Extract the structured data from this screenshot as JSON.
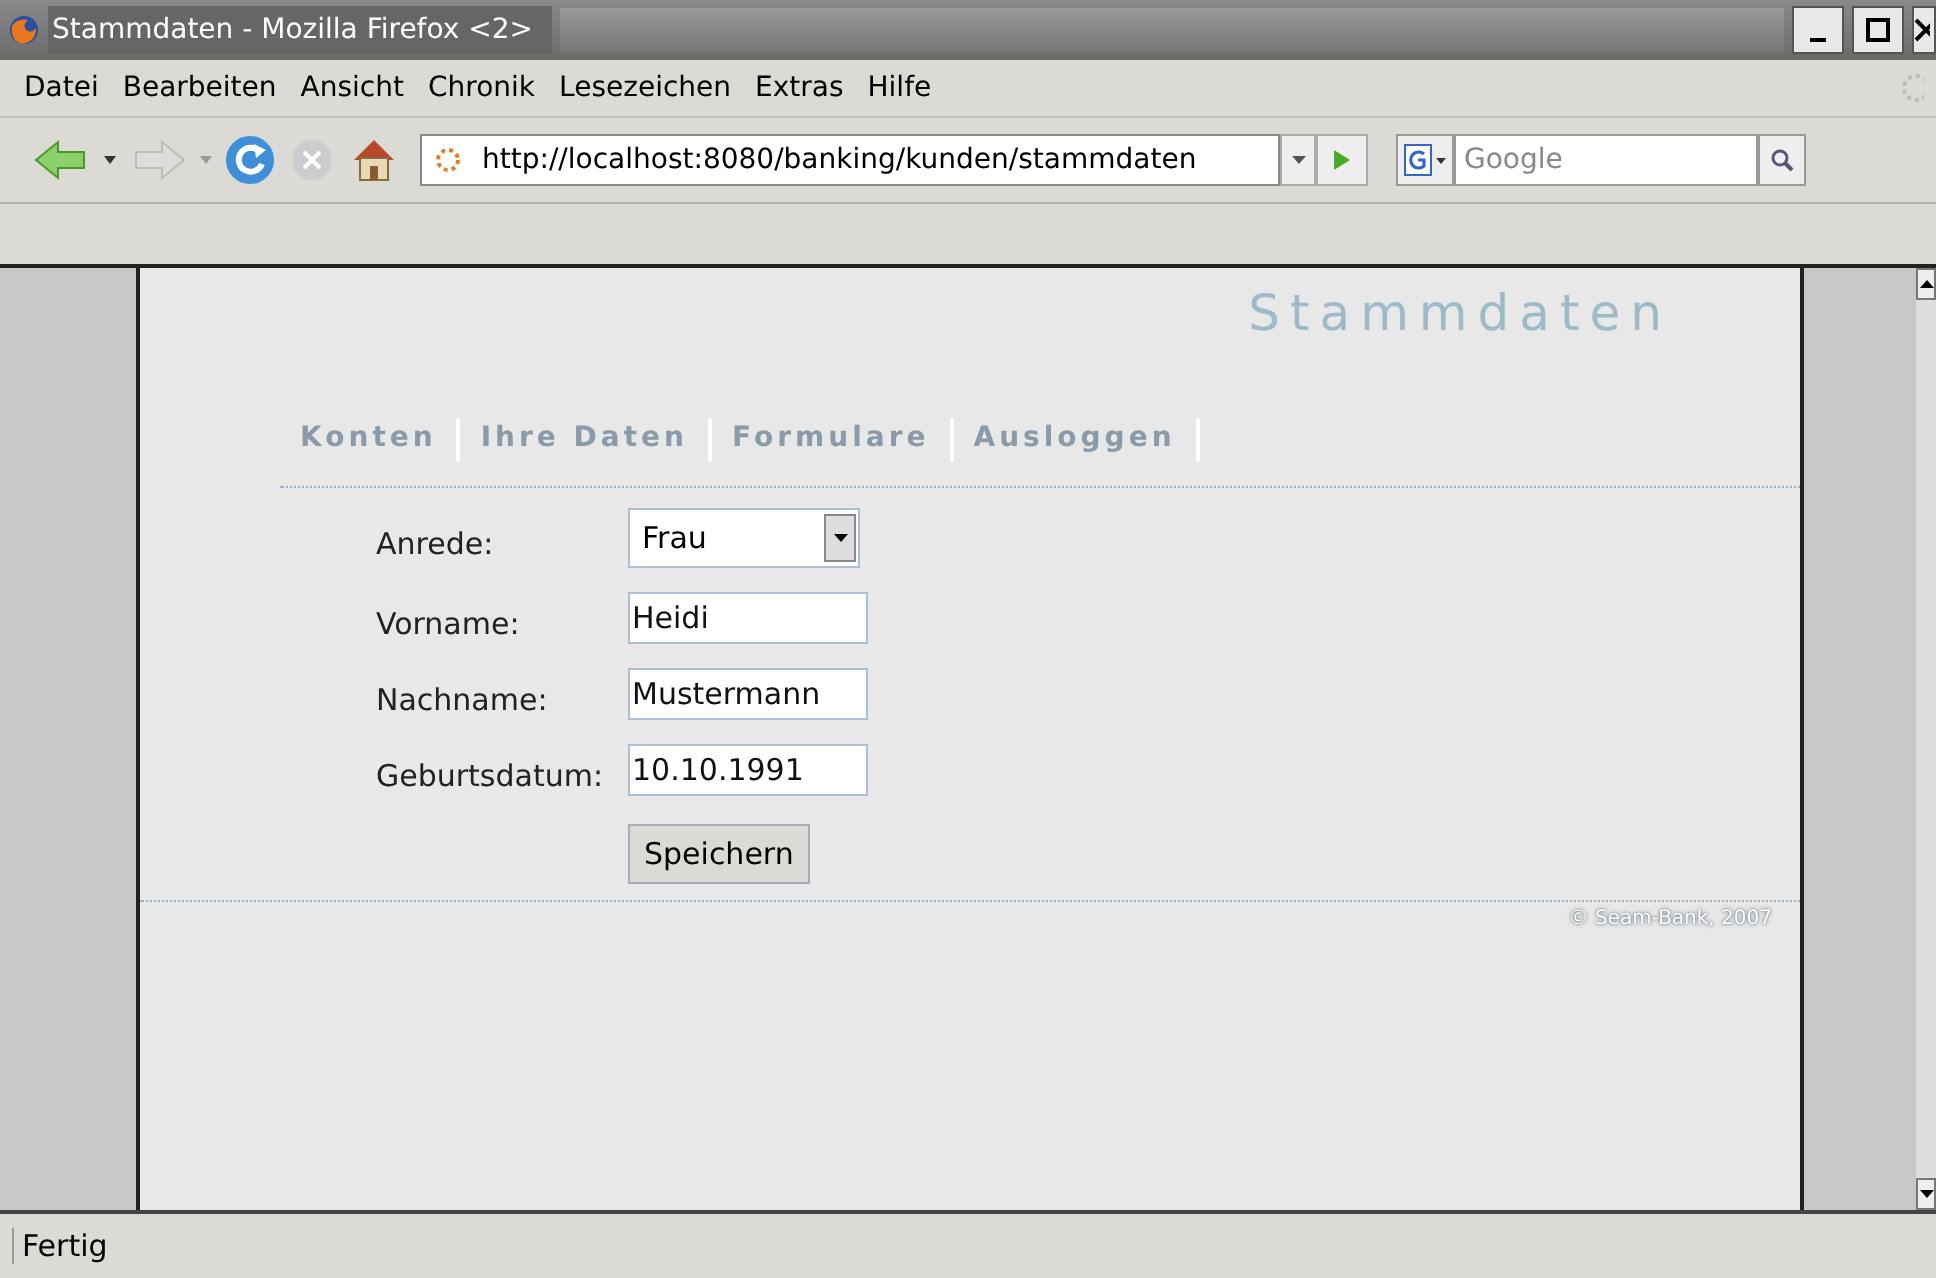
{
  "window": {
    "title": "Stammdaten - Mozilla Firefox <2>"
  },
  "menu": [
    "Datei",
    "Bearbeiten",
    "Ansicht",
    "Chronik",
    "Lesezeichen",
    "Extras",
    "Hilfe"
  ],
  "toolbar": {
    "url": "http://localhost:8080/banking/kunden/stammdaten",
    "search": {
      "placeholder": "Google"
    }
  },
  "page": {
    "heading": "Stammdaten",
    "nav": [
      "Konten",
      "Ihre Daten",
      "Formulare",
      "Ausloggen"
    ],
    "form": [
      {
        "kind": "select",
        "label": "Anrede:",
        "value": "Frau"
      },
      {
        "kind": "text",
        "label": "Vorname:",
        "value": "Heidi"
      },
      {
        "kind": "text",
        "label": "Nachname:",
        "value": "Mustermann"
      },
      {
        "kind": "text",
        "label": "Geburtsdatum:",
        "value": "10.10.1991"
      }
    ],
    "submit": "Speichern",
    "footer": "© Seam-Bank, 2007"
  },
  "status_bar": "Fertig"
}
